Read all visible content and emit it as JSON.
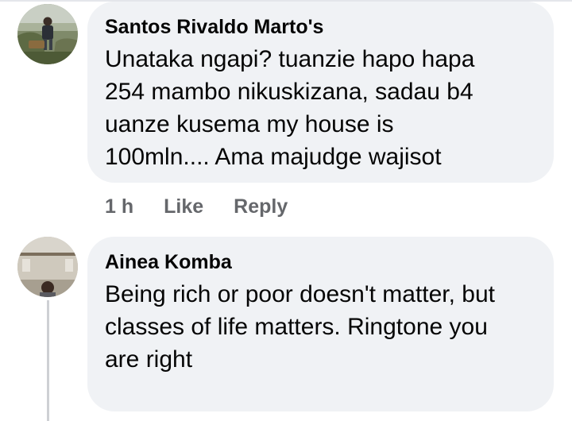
{
  "comments": [
    {
      "author": "Santos Rivaldo Marto's",
      "text": "Unataka ngapi? tuanzie hapo hapa\n254 mambo nikuskizana, sadau b4\nuanze kusema my house is\n100mln.... Ama majudge wajisot",
      "avatar_icon": "profile-photo-person-outdoors",
      "actions": {
        "timestamp": "1 h",
        "like_label": "Like",
        "reply_label": "Reply"
      }
    },
    {
      "author": "Ainea Komba",
      "text": "Being rich or poor doesn't matter, but\nclasses of life matters. Ringtone you\nare right",
      "avatar_icon": "profile-photo-person-indoors"
    }
  ],
  "colors": {
    "bubble_background": "#f0f2f5",
    "text_primary": "#050505",
    "text_secondary": "#65676b",
    "thread_line": "#ced0d4"
  }
}
